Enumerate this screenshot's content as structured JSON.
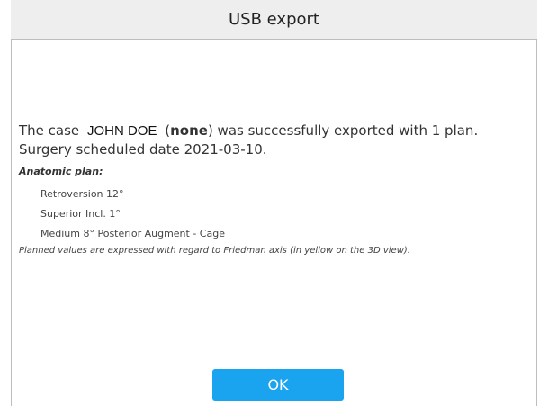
{
  "dialog": {
    "title": "USB export",
    "message": {
      "prefix": "The case",
      "patient_name": "JOHN DOE",
      "open_paren": "(",
      "status": "none",
      "suffix_line1": ") was successfully exported with 1 plan.",
      "line2": "Surgery scheduled date 2021-03-10."
    },
    "plan_heading": "Anatomic plan:",
    "plan_items": [
      "Retroversion 12°",
      "Superior Incl. 1°",
      "Medium 8° Posterior Augment - Cage"
    ],
    "note": "Planned values are expressed with regard to Friedman axis (in yellow on the 3D view).",
    "ok_label": "OK"
  },
  "colors": {
    "titlebar_background": "#eeeeee",
    "button_background": "#1aa3ef",
    "button_text": "#ffffff",
    "border": "#bdbdbd"
  }
}
